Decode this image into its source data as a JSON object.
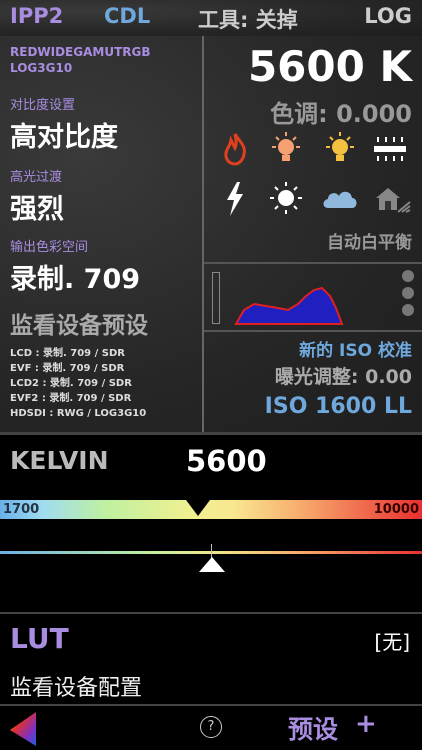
{
  "top": {
    "ipp2": "IPP2",
    "cdl": "CDL",
    "tools": "工具: 关掉",
    "log": "LOG"
  },
  "left": {
    "gamut_line1": "REDWIDEGAMUTRGB",
    "gamut_line2": "LOG3G10",
    "contrast_label": "对比度设置",
    "contrast_value": "高对比度",
    "highlight_label": "高光过渡",
    "highlight_value": "强烈",
    "output_label": "输出色彩空间",
    "output_value": "录制. 709",
    "monitor_title": "监看设备预设",
    "monitors": [
      "LCD : 录制. 709 / SDR",
      "EVF : 录制. 709 / SDR",
      "LCD2 : 录制. 709 / SDR",
      "EVF2 : 录制. 709 / SDR",
      "HDSDI : RWG / LOG3G10"
    ]
  },
  "right": {
    "kelvin_value": "5600 K",
    "tint": "色调: 0.000",
    "auto_wb": "自动白平衡",
    "new_iso": "新的 ISO 校准",
    "exposure": "曝光调整: 0.00",
    "iso": "ISO 1600 LL",
    "wb_icons": [
      "flame-icon",
      "bulb-icon",
      "bulb-yellow-icon",
      "fluorescent-icon",
      "flash-icon",
      "sun-icon",
      "cloud-icon",
      "shade-icon"
    ]
  },
  "kelvin": {
    "label": "KELVIN",
    "value": "5600",
    "min": "1700",
    "max": "10000",
    "position": 0.47
  },
  "lut": {
    "label": "LUT",
    "value": "[无]"
  },
  "monitor_config": "监看设备配置",
  "bottom": {
    "help": "?",
    "presets": "预设",
    "add": "+"
  },
  "colors": {
    "purple": "#a98de0",
    "blue": "#6fa8dc"
  }
}
